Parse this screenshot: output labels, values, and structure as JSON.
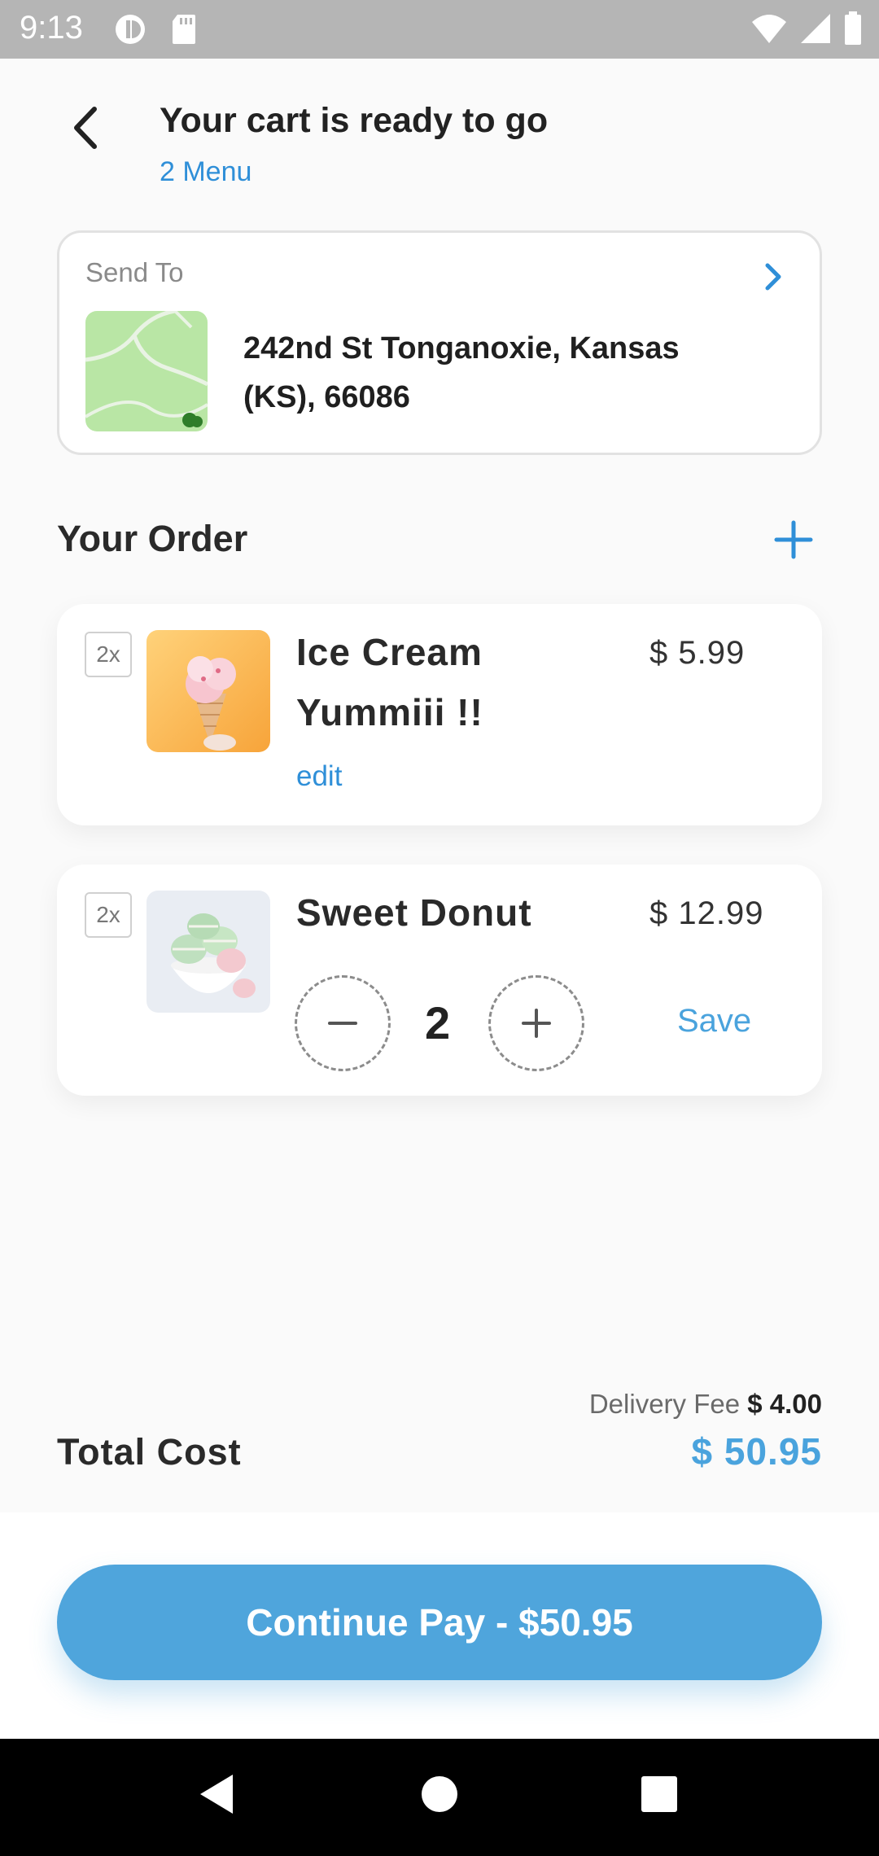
{
  "status_bar": {
    "time": "9:13"
  },
  "header": {
    "title": "Your cart is ready to go",
    "subtitle": "2 Menu"
  },
  "address": {
    "label": "Send To",
    "line1": "242nd St Tonganoxie, Kansas",
    "line2": "(KS), 66086"
  },
  "order": {
    "heading": "Your Order",
    "items": [
      {
        "qty": "2x",
        "name_line1": "Ice Cream",
        "name_line2": "Yummiii !!",
        "price": "$ 5.99",
        "edit": "edit"
      },
      {
        "qty": "2x",
        "name": "Sweet Donut",
        "price": "$ 12.99",
        "count": "2",
        "save": "Save"
      }
    ]
  },
  "totals": {
    "fee_label": "Delivery Fee",
    "fee_value": "$ 4.00",
    "total_label": "Total Cost",
    "total_value": "$ 50.95"
  },
  "pay": {
    "button_label": "Continue Pay - $50.95"
  },
  "colors": {
    "accent": "#2f8fd8",
    "button": "#4fa5dc",
    "background": "#fafafa"
  }
}
